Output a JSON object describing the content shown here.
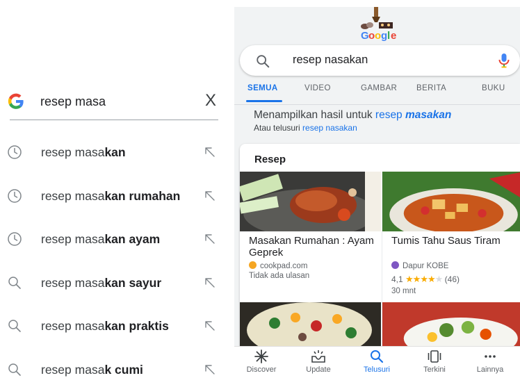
{
  "autocomplete": {
    "query": "resep masa",
    "clear_glyph": "X",
    "suggestions": [
      {
        "typed": "resep masa",
        "completion": "kan",
        "type": "history"
      },
      {
        "typed": "resep masa",
        "completion": "kan rumahan",
        "type": "history"
      },
      {
        "typed": "resep masa",
        "completion": "kan ayam",
        "type": "history"
      },
      {
        "typed": "resep masa",
        "completion": "kan sayur",
        "type": "search"
      },
      {
        "typed": "resep masa",
        "completion": "kan praktis",
        "type": "search"
      },
      {
        "typed": "resep masa",
        "completion": "k cumi",
        "type": "search"
      }
    ]
  },
  "results": {
    "search_query": "resep nasakan",
    "tabs": [
      {
        "label": "SEMUA",
        "active": true
      },
      {
        "label": "VIDEO",
        "active": false
      },
      {
        "label": "GAMBAR",
        "active": false
      },
      {
        "label": "BERITA",
        "active": false
      },
      {
        "label": "BUKU",
        "active": false
      }
    ],
    "showing_prefix": "Menampilkan hasil untuk ",
    "showing_link_plain": "resep ",
    "showing_link_bold": "masakan",
    "alt_prefix": "Atau telusuri ",
    "alt_link": "resep nasakan",
    "card_title": "Resep",
    "recipes": [
      {
        "name": "Masakan Rumahan : Ayam Geprek",
        "source": "cookpad.com",
        "meta": "Tidak ada ulasan"
      },
      {
        "name": "Tumis Tahu Saus Tiram",
        "source": "Dapur KOBE",
        "rating": "4,1",
        "stars": 4,
        "reviews": "(46)",
        "time": "30 mnt"
      }
    ],
    "bottom_nav": [
      {
        "label": "Discover",
        "icon": "asterisk-icon",
        "active": false
      },
      {
        "label": "Update",
        "icon": "inbox-sparkle-icon",
        "active": false
      },
      {
        "label": "Telusuri",
        "icon": "search-icon",
        "active": true
      },
      {
        "label": "Terkini",
        "icon": "recent-cards-icon",
        "active": false
      },
      {
        "label": "Lainnya",
        "icon": "more-dots-icon",
        "active": false
      }
    ]
  },
  "colors": {
    "accent_blue": "#1a73e8",
    "star": "#f9ab00",
    "background_gray": "#f1f3f4"
  }
}
